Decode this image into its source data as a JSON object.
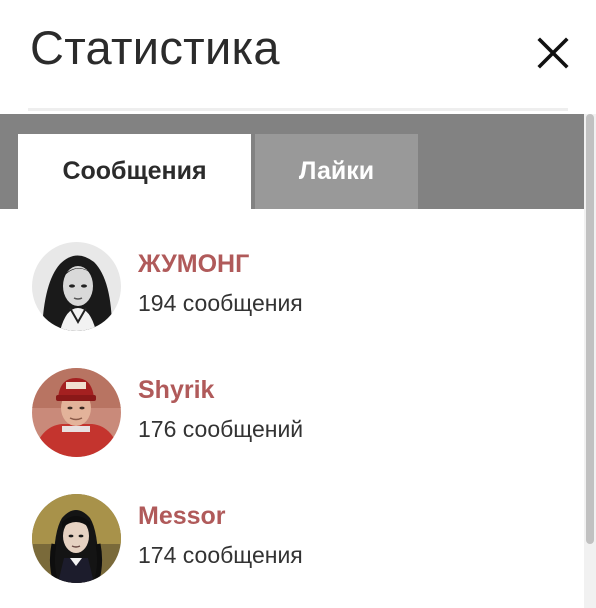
{
  "dialog": {
    "title": "Статистика",
    "close_icon": "close-icon"
  },
  "tabs": [
    {
      "label": "Сообщения",
      "active": true
    },
    {
      "label": "Лайки",
      "active": false
    }
  ],
  "colors": {
    "username": "#b05a5a",
    "tabbar_bg": "#828282",
    "inactive_tab_bg": "#999999"
  },
  "users": [
    {
      "name": "ЖУМОНГ",
      "count_text": "194 сообщения",
      "avatar_icon": "avatar-image"
    },
    {
      "name": "Shyrik",
      "count_text": "176 сообщений",
      "avatar_icon": "avatar-image"
    },
    {
      "name": "Messor",
      "count_text": "174 сообщения",
      "avatar_icon": "avatar-image"
    }
  ]
}
